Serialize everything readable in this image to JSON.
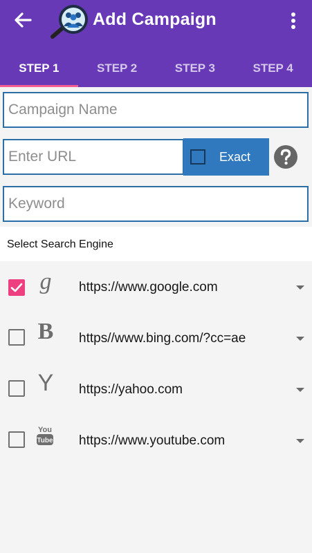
{
  "appbar": {
    "title": "Add Campaign",
    "back_icon": "arrow-back-icon",
    "logo_icon": "magnifier-users-logo",
    "menu_icon": "more-vert-icon",
    "color": "#6739b6"
  },
  "tabs": [
    {
      "label": "STEP 1",
      "active": true
    },
    {
      "label": "STEP 2",
      "active": false
    },
    {
      "label": "STEP 3",
      "active": false
    },
    {
      "label": "STEP 4",
      "active": false
    }
  ],
  "form": {
    "campaign_name": {
      "placeholder": "Campaign Name",
      "value": ""
    },
    "url": {
      "placeholder": "Enter URL",
      "value": ""
    },
    "exact": {
      "label": "Exact",
      "checked": false
    },
    "help_icon": "help-circle-icon",
    "keyword": {
      "placeholder": "Keyword",
      "value": ""
    }
  },
  "search_engines": {
    "title": "Select Search Engine",
    "items": [
      {
        "icon": "google-icon",
        "icon_text": "g",
        "url": "https://www.google.com",
        "checked": true
      },
      {
        "icon": "bing-icon",
        "icon_text": "B",
        "url": "https//www.bing.com/?cc=ae",
        "checked": false
      },
      {
        "icon": "yahoo-icon",
        "icon_text": "Y",
        "url": "https://yahoo.com",
        "checked": false
      },
      {
        "icon": "youtube-icon",
        "icon_text": "You Tube",
        "url": "https://www.youtube.com",
        "checked": false
      }
    ]
  },
  "colors": {
    "accent": "#ee3f80",
    "button": "#3079bf",
    "border": "#2c6fa8"
  }
}
